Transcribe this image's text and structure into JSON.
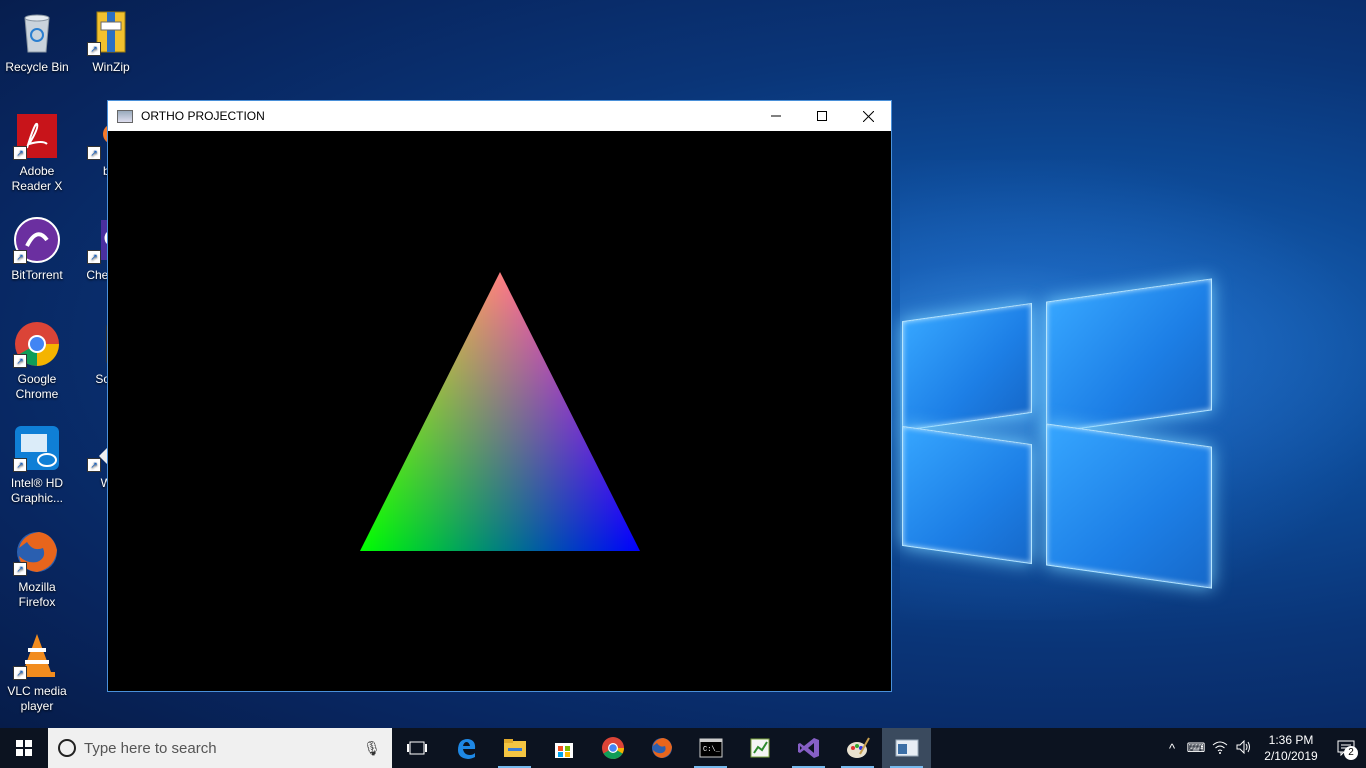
{
  "desktop": {
    "icons": [
      {
        "label": "Recycle Bin",
        "icon": "recycle-bin-icon"
      },
      {
        "label": "WinZip",
        "icon": "winzip-icon"
      },
      {
        "label": "Adobe Reader X",
        "icon": "adobe-reader-icon"
      },
      {
        "label": "ble",
        "icon": "blender-icon"
      },
      {
        "label": "BitTorrent",
        "icon": "bittorrent-icon"
      },
      {
        "label": "Check Er",
        "icon": "check-icon"
      },
      {
        "label": "Google Chrome",
        "icon": "chrome-icon"
      },
      {
        "label": "Sourc",
        "icon": "source-icon"
      },
      {
        "label": "Intel® HD Graphic...",
        "icon": "intel-graphics-icon"
      },
      {
        "label": "Win",
        "icon": "winrar-icon"
      },
      {
        "label": "Mozilla Firefox",
        "icon": "firefox-icon"
      },
      {
        "label": "VLC media player",
        "icon": "vlc-icon"
      }
    ]
  },
  "window": {
    "title": "ORTHO PROJECTION",
    "minimize": "—",
    "maximize": "☐",
    "close": "✕",
    "triangle_colors": {
      "top": "#ff0000",
      "left": "#00ff00",
      "right": "#0000ff"
    }
  },
  "taskbar": {
    "search_placeholder": "Type here to search",
    "apps": [
      "task-view-icon",
      "edge-icon",
      "file-explorer-icon",
      "store-icon",
      "chrome-icon",
      "firefox-icon",
      "cmd-icon",
      "chart-app-icon",
      "visual-studio-icon",
      "paint-icon",
      "ortho-window-icon"
    ],
    "time": "1:36 PM",
    "date": "2/10/2019",
    "notification_count": "2"
  }
}
